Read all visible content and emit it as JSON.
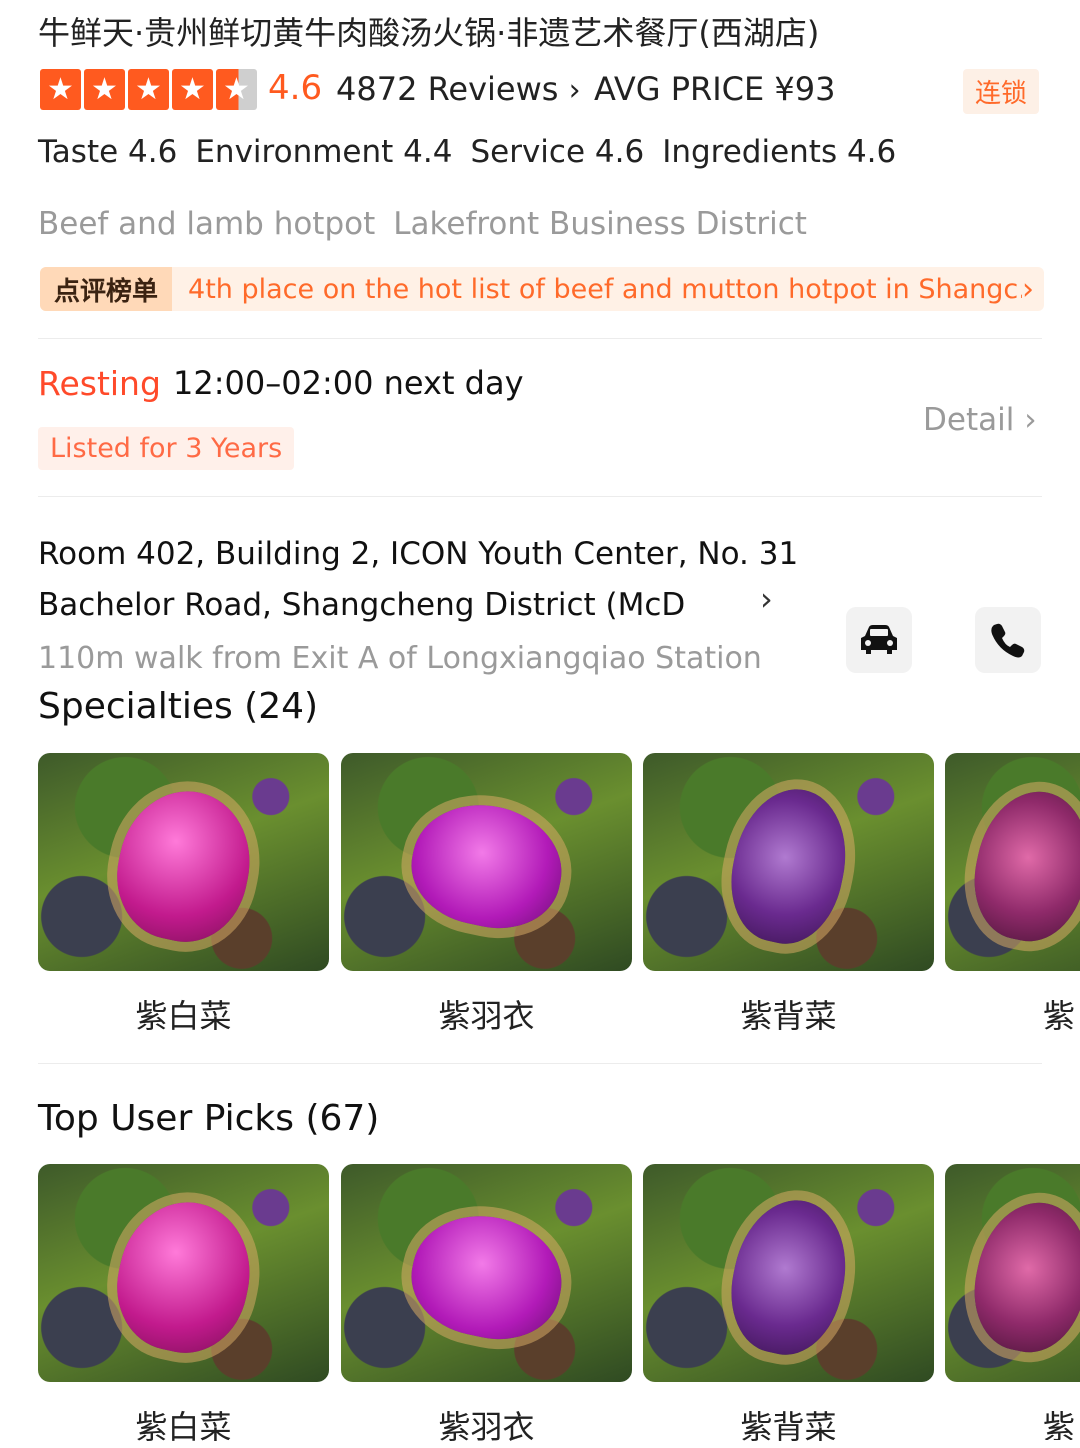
{
  "shop": {
    "title": "牛鲜天·贵州鲜切黄牛肉酸汤火锅·非遗艺术餐厅(西湖店)",
    "rating": "4.6",
    "reviews": "4872 Reviews",
    "avg_price": "AVG PRICE ¥93",
    "chain_tag": "连锁",
    "scores": [
      "Taste 4.6",
      "Environment 4.4",
      "Service 4.6",
      "Ingredients 4.6"
    ],
    "categories": [
      "Beef and lamb hotpot",
      "Lakefront Business District"
    ]
  },
  "rank": {
    "badge": "点评榜单",
    "text": "4th place on the hot list of beef and mutton hotpot in Shangc..."
  },
  "hours": {
    "status": "Resting",
    "time": "12:00–02:00 next day",
    "listed": "Listed for 3 Years",
    "detail": "Detail"
  },
  "address": {
    "text": "Room 402, Building 2, ICON Youth Center, No. 31 Bachelor Road, Shangcheng District (McD",
    "walk": "110m walk from Exit A of Longxiangqiao Station"
  },
  "icons": {
    "car": "car-icon",
    "phone": "phone-icon",
    "star": "star-icon",
    "chevron": "chevron-right-icon"
  },
  "specialties": {
    "title": "Specialties (24)",
    "items": [
      "紫白菜",
      "紫羽衣",
      "紫背菜",
      "紫"
    ]
  },
  "top_picks": {
    "title": "Top User Picks (67)",
    "items": [
      "紫白菜",
      "紫羽衣",
      "紫背菜",
      "紫"
    ]
  },
  "colors": {
    "accent": "#ff5a1f",
    "resting": "#ff4a2a",
    "muted": "#9a9a9a"
  }
}
